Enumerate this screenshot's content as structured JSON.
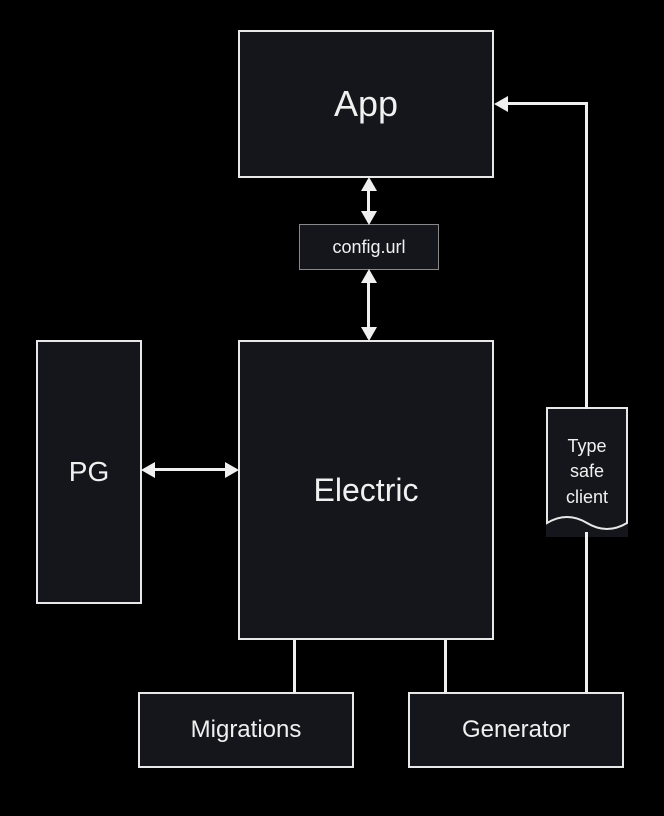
{
  "nodes": {
    "app": "App",
    "config": "config.url",
    "pg": "PG",
    "electric": "Electric",
    "migrations": "Migrations",
    "generator": "Generator",
    "typesafe": "Type\nsafe\nclient"
  }
}
